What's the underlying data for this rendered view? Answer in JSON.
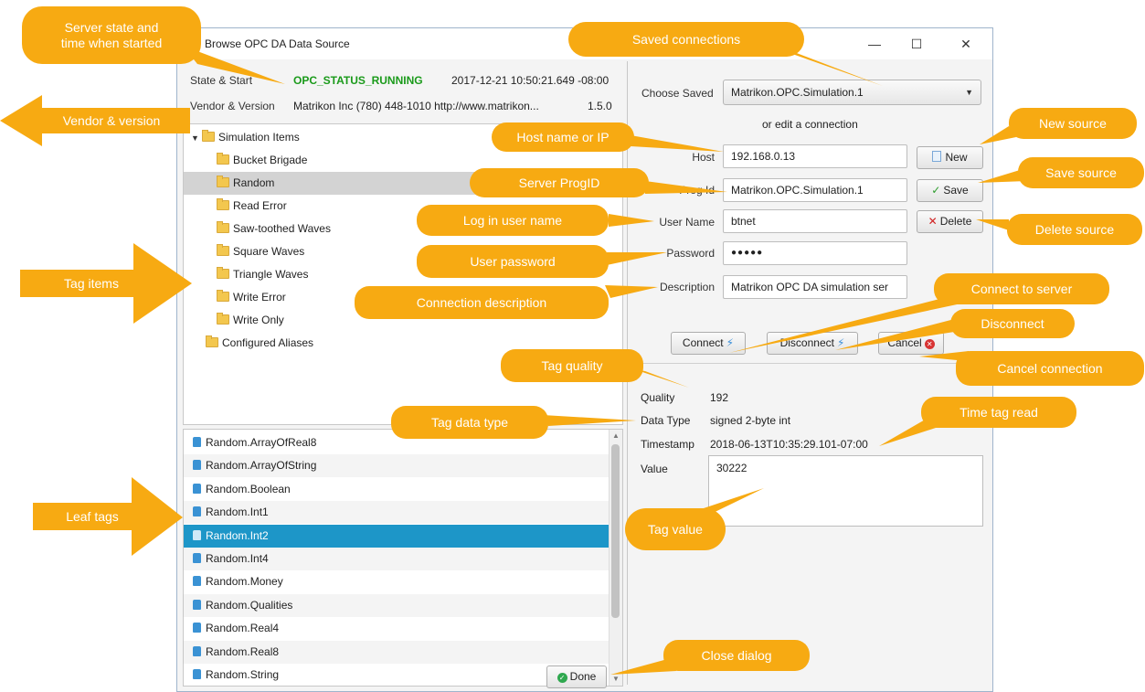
{
  "window": {
    "title": "Browse OPC DA Data Source",
    "controls": {
      "minimize": "—",
      "maximize": "☐",
      "close": "✕"
    }
  },
  "server_info": {
    "state_label": "State & Start",
    "state_value": "OPC_STATUS_RUNNING",
    "start_time": "2017-12-21 10:50:21.649 -08:00",
    "vendor_label": "Vendor & Version",
    "vendor_value": "Matrikon Inc (780) 448-1010 http://www.matrikon...",
    "version": "1.5.0"
  },
  "tree": {
    "root": "Simulation Items",
    "items": [
      {
        "label": "Bucket Brigade",
        "selected": false
      },
      {
        "label": "Random",
        "selected": true
      },
      {
        "label": "Read Error",
        "selected": false
      },
      {
        "label": "Saw-toothed Waves",
        "selected": false
      },
      {
        "label": "Square Waves",
        "selected": false
      },
      {
        "label": "Triangle Waves",
        "selected": false
      },
      {
        "label": "Write Error",
        "selected": false
      },
      {
        "label": "Write Only",
        "selected": false
      }
    ],
    "second_root": "Configured Aliases"
  },
  "leaf_tags": {
    "items": [
      "Random.ArrayOfReal8",
      "Random.ArrayOfString",
      "Random.Boolean",
      "Random.Int1",
      "Random.Int2",
      "Random.Int4",
      "Random.Money",
      "Random.Qualities",
      "Random.Real4",
      "Random.Real8",
      "Random.String"
    ],
    "selected": "Random.Int2"
  },
  "connection": {
    "choose_label": "Choose Saved",
    "choose_value": "Matrikon.OPC.Simulation.1",
    "or_edit": "or edit a connection",
    "host_label": "Host",
    "host_value": "192.168.0.13",
    "progid_label": "Prog Id",
    "progid_value": "Matrikon.OPC.Simulation.1",
    "user_label": "User Name",
    "user_value": "btnet",
    "password_label": "Password",
    "password_value": "●●●●●",
    "description_label": "Description",
    "description_value": "Matrikon OPC DA simulation ser"
  },
  "buttons": {
    "new": "New",
    "save": "Save",
    "delete": "Delete",
    "connect": "Connect",
    "disconnect": "Disconnect",
    "cancel": "Cancel",
    "done": "Done"
  },
  "tag_details": {
    "quality_label": "Quality",
    "quality_value": "192",
    "datatype_label": "Data Type",
    "datatype_value": "signed 2-byte int",
    "timestamp_label": "Timestamp",
    "timestamp_value": "2018-06-13T10:35:29.101-07:00",
    "value_label": "Value",
    "value_value": "30222"
  },
  "annotations": {
    "server_state": "Server state and\ntime when started",
    "saved_connections": "Saved connections",
    "vendor_version": "Vendor & version",
    "host_name": "Host name or IP",
    "new_source": "New source",
    "server_progid": "Server ProgID",
    "save_source": "Save source",
    "login_user": "Log in user name",
    "delete_source": "Delete source",
    "user_password": "User password",
    "tag_items": "Tag items",
    "connection_description": "Connection description",
    "connect_server": "Connect to server",
    "disconnect": "Disconnect",
    "tag_quality": "Tag quality",
    "cancel_connection": "Cancel connection",
    "tag_data_type": "Tag data type",
    "time_tag_read": "Time tag read",
    "leaf_tags": "Leaf tags",
    "tag_value": "Tag value",
    "close_dialog": "Close dialog"
  },
  "colors": {
    "annotation": "#f7aa12",
    "running_status": "#1a9a1a",
    "list_selection": "#1d96c8",
    "tree_selection": "#d3d3d3"
  }
}
